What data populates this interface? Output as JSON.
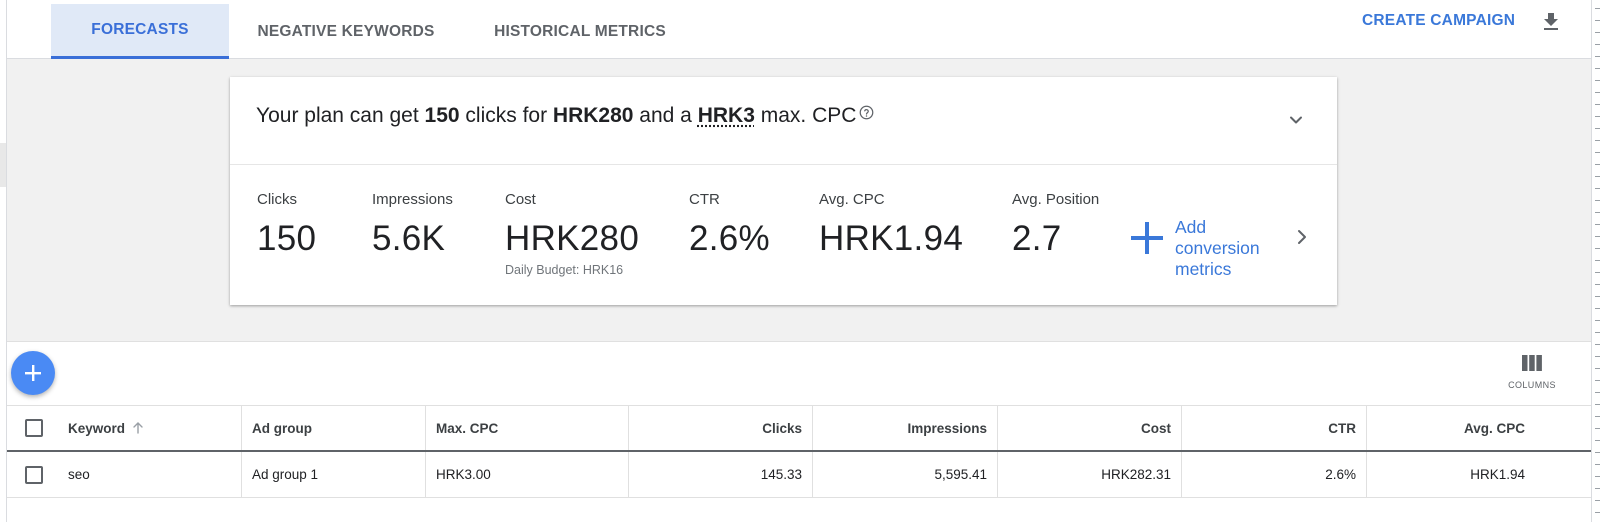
{
  "tabs": [
    {
      "label": "FORECASTS",
      "active": true
    },
    {
      "label": "NEGATIVE KEYWORDS",
      "active": false
    },
    {
      "label": "HISTORICAL METRICS",
      "active": false
    }
  ],
  "header_actions": {
    "create_campaign": "CREATE CAMPAIGN",
    "download_icon": "download-icon"
  },
  "summary": {
    "headline": {
      "prefix": "Your plan can get ",
      "clicks": "150",
      "mid1": " clicks for ",
      "cost": "HRK280",
      "mid2": " and a ",
      "max_cpc": "HRK3",
      "suffix": " max. CPC"
    },
    "metrics": [
      {
        "label": "Clicks",
        "value": "150"
      },
      {
        "label": "Impressions",
        "value": "5.6K"
      },
      {
        "label": "Cost",
        "value": "HRK280",
        "sub": "Daily Budget: HRK16"
      },
      {
        "label": "CTR",
        "value": "2.6%"
      },
      {
        "label": "Avg. CPC",
        "value": "HRK1.94"
      },
      {
        "label": "Avg. Position",
        "value": "2.7"
      }
    ],
    "add_conversion": "Add conversion metrics"
  },
  "toolbar": {
    "columns_label": "COLUMNS"
  },
  "table": {
    "headers": [
      "Keyword",
      "Ad group",
      "Max. CPC",
      "Clicks",
      "Impressions",
      "Cost",
      "CTR",
      "Avg. CPC"
    ],
    "rows": [
      [
        "seo",
        "Ad group 1",
        "HRK3.00",
        "145.33",
        "5,595.41",
        "HRK282.31",
        "2.6%",
        "HRK1.94"
      ]
    ]
  },
  "colors": {
    "accent": "#3a78d9",
    "active_tab_bg": "#e0e9f7",
    "fab": "#4a8af4",
    "summary_bg": "#f1f1f1"
  }
}
